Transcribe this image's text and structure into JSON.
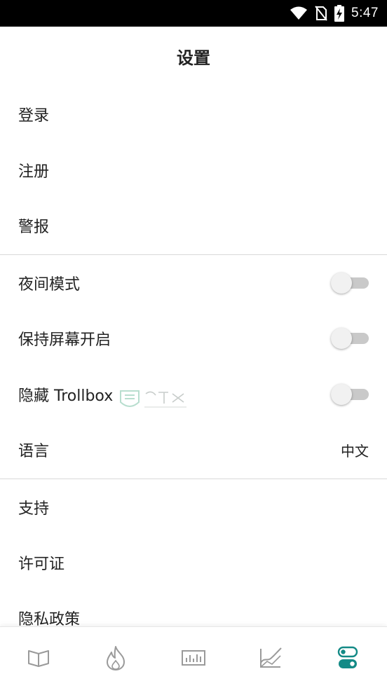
{
  "status_bar": {
    "time": "5:47",
    "icons": [
      "wifi-icon",
      "no-sim-icon",
      "battery-charging-icon"
    ]
  },
  "header": {
    "title": "设置"
  },
  "account_items": [
    {
      "label": "登录"
    },
    {
      "label": "注册"
    },
    {
      "label": "警报"
    }
  ],
  "preferences": {
    "night_mode": {
      "label": "夜间模式",
      "enabled": false
    },
    "keep_screen_on": {
      "label": "保持屏幕开启",
      "enabled": false
    },
    "hide_trollbox": {
      "label": "隐藏 Trollbox",
      "enabled": false
    },
    "language": {
      "label": "语言",
      "value": "中文"
    }
  },
  "about_items": [
    {
      "label": "支持"
    },
    {
      "label": "许可证"
    },
    {
      "label": "隐私政策"
    }
  ],
  "bottom_nav": [
    {
      "icon": "book-icon",
      "active": false
    },
    {
      "icon": "flame-icon",
      "active": false
    },
    {
      "icon": "volume-chart-icon",
      "active": false
    },
    {
      "icon": "line-chart-icon",
      "active": false
    },
    {
      "icon": "settings-toggle-icon",
      "active": true
    }
  ],
  "colors": {
    "accent": "#138a86",
    "icon_inactive": "#9a9a9a",
    "toggle_track": "#c9c9c9",
    "toggle_knob": "#f1f1f1",
    "divider": "#d9d9d9"
  }
}
